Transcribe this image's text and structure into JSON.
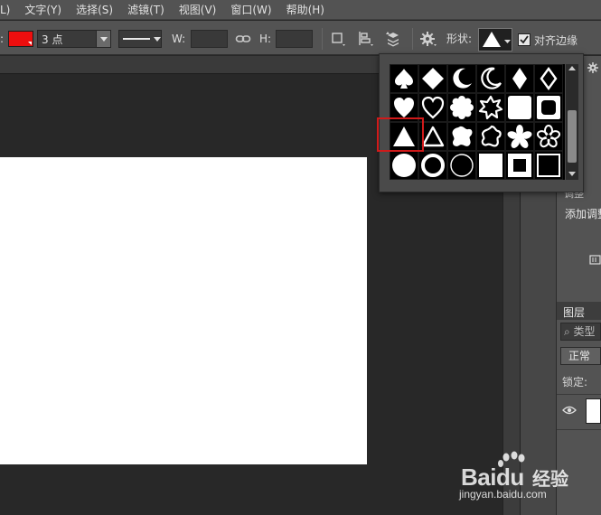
{
  "menubar": {
    "items": [
      "L)",
      "文字(Y)",
      "选择(S)",
      "滤镜(T)",
      "视图(V)",
      "窗口(W)",
      "帮助(H)"
    ]
  },
  "options": {
    "fill_label": ":",
    "fill_color": "#ee0e0e",
    "stroke_width": "3 点",
    "w_label": "W:",
    "h_label": "H:",
    "shape_label": "形状:",
    "align_edges_label": "对齐边缘",
    "align_edges_checked": true
  },
  "shape_picker": {
    "shapes": [
      "spade",
      "diamond-filled",
      "crescent-filled",
      "crescent-outline",
      "diamond-tall",
      "diamond-outline",
      "heart-filled",
      "heart-outline",
      "flower-8",
      "star-burst-outline",
      "square-filled",
      "rounded-square-outline",
      "triangle-filled",
      "triangle-outline",
      "blob-filled",
      "blob-outline",
      "star-5-rounded",
      "flower-5-outline",
      "circle-filled",
      "circle-ring-thick",
      "circle-ring-thin",
      "square-white",
      "square-frame",
      "square-dark"
    ],
    "selected_index": 12
  },
  "panels": {
    "adjust_tab": "调整",
    "add_adjust": "添加调整",
    "layers_tab": "图层",
    "filter_placeholder": "类型",
    "blend_mode": "正常",
    "lock_label": "锁定:"
  },
  "watermark": {
    "brand": "Bai",
    "brand2": "du",
    "cn": "经验",
    "url": "jingyan.baidu.com"
  }
}
